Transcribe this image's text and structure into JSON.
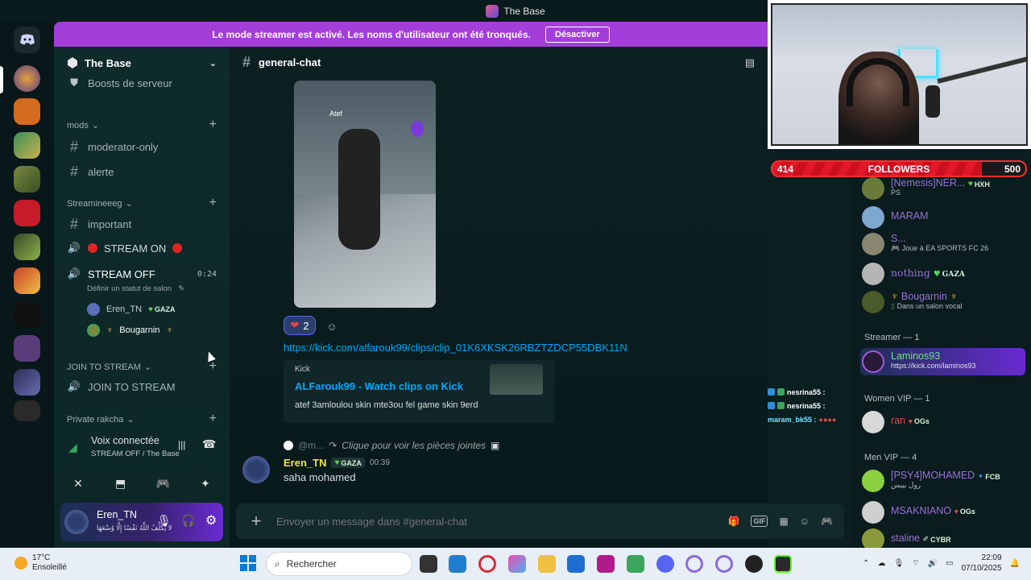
{
  "window": {
    "title": "The Base"
  },
  "banner": {
    "text": "Le mode streamer est activé. Les noms d'utilisateur ont été tronqués.",
    "button": "Désactiver"
  },
  "server": {
    "name": "The Base"
  },
  "sidebar": {
    "top_item": "Boosts de serveur",
    "categories": [
      {
        "name": "mods"
      },
      {
        "name": "Streamineeeg"
      },
      {
        "name": "JOIN TO STREAM"
      },
      {
        "name": "Private rakcha"
      }
    ],
    "channels": {
      "moderator_only": "moderator-only",
      "alerte": "alerte",
      "important": "important",
      "stream_on": "STREAM ON",
      "stream_off": "STREAM OFF",
      "stream_off_time": "0:24",
      "stream_off_status": "Définir un statut de salon",
      "join_to_stream": "JOIN TO STREAM"
    },
    "voice_users": [
      {
        "name": "Eren_TN",
        "tag": "GAZA"
      },
      {
        "name": "Bougarnin"
      }
    ],
    "voice_panel": {
      "title": "Voix connectée",
      "subtitle": "STREAM OFF / The Base"
    },
    "user_panel": {
      "name": "Eren_TN",
      "status": "لا يُكَلِّفُ اللَّهُ نَفْسًا إِلَّا وُسْعَهَا"
    }
  },
  "chat": {
    "channel": "general-chat",
    "clip_overlay_name": "Atef",
    "reaction": {
      "emoji": "❤",
      "count": "2"
    },
    "link": "https://kick.com/alfarouk99/clips/clip_01K6XKSK26RBZTZDCP55DBK11N",
    "embed": {
      "provider": "Kick",
      "title": "ALFarouk99 - Watch clips on Kick",
      "description": "atef 3amloulou skin mte3ou fel game skin 9erd"
    },
    "reply": {
      "author": "@m...",
      "text": "Clique pour voir les pièces jointes"
    },
    "message": {
      "author": "Eren_TN",
      "tag": "GAZA",
      "time": "00:39",
      "text": "saha mohamed"
    },
    "composer_placeholder": "Envoyer un message dans #general-chat"
  },
  "follow_goal": {
    "current": "414",
    "label": "FOLLOWERS",
    "target": "500",
    "progress": 0.828
  },
  "chat_overlay": [
    {
      "user": "nesrina55 :"
    },
    {
      "user": "nesrina55 :"
    },
    {
      "user": "maram_bk55 :"
    }
  ],
  "members": {
    "top": [
      {
        "name": "[Nemesis]NER...",
        "tag": "HXH",
        "sub": "PS"
      },
      {
        "name": "MARAM"
      },
      {
        "name": "S...",
        "sub": "Joue à EA SPORTS FC 26"
      },
      {
        "name": "nothing",
        "tag": "GAZA"
      },
      {
        "name": "Bougarnin",
        "sub": "Dans un salon vocal"
      }
    ],
    "streamer_section": "Streamer — 1",
    "streamer": {
      "name": "Laminos93",
      "sub": "https://kick.com/laminos93"
    },
    "women_vip_section": "Women VIP — 1",
    "women_vip": {
      "name": "ran",
      "tag": "OGs"
    },
    "men_vip_section": "Men VIP — 4",
    "men_vip": [
      {
        "name": "[PSY4]MOHAMED",
        "tag": "FCB",
        "sub": "رول بيبس"
      },
      {
        "name": "MSAKNIANO",
        "tag": "OGs"
      },
      {
        "name": "staline",
        "tag": "CYBR"
      }
    ]
  },
  "taskbar": {
    "weather_temp": "17°C",
    "weather_desc": "Ensoleillé",
    "search_placeholder": "Rechercher",
    "time": "22:09",
    "date": "07/10/2025"
  }
}
